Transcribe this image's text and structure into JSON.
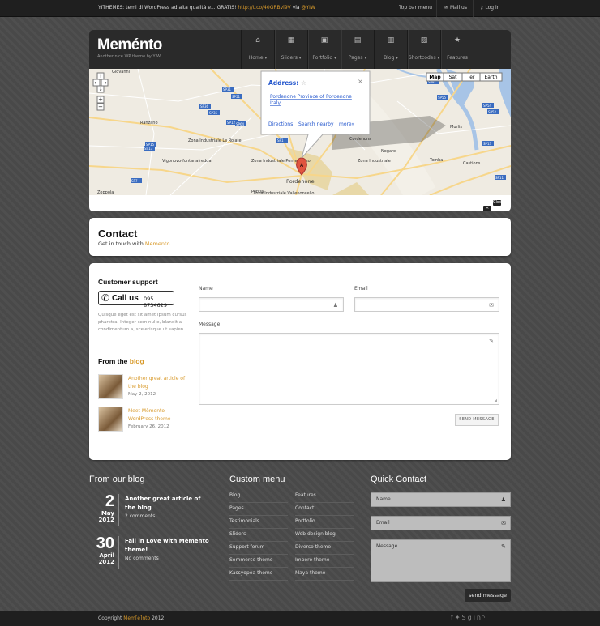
{
  "topbar": {
    "tweet_prefix": "YITHEMES: temi di WordPress ad alta qualità e... GRATIS!",
    "tweet_link": "http://t.co/40GRBvl9V",
    "tweet_via": "via",
    "tweet_user": "@YIW",
    "menu": "Top bar menu",
    "mail": "Mail us",
    "login": "Log in"
  },
  "header": {
    "logo_a": "Mem",
    "logo_accent": "é",
    "logo_b": "nto",
    "tagline": "Another nice WP theme by YIW",
    "nav": [
      {
        "label": "Home",
        "icon": "home-icon",
        "glyph": "⌂",
        "dd": true
      },
      {
        "label": "Sliders",
        "icon": "film-icon",
        "glyph": "▦",
        "dd": true
      },
      {
        "label": "Portfolio",
        "icon": "image-icon",
        "glyph": "▣",
        "dd": true
      },
      {
        "label": "Pages",
        "icon": "document-icon",
        "glyph": "▤",
        "dd": true
      },
      {
        "label": "Blog",
        "icon": "blog-icon",
        "glyph": "▥",
        "dd": true
      },
      {
        "label": "Shortcodes",
        "icon": "code-icon",
        "glyph": "▧",
        "dd": true
      },
      {
        "label": "Features",
        "icon": "star-icon",
        "glyph": "★",
        "dd": false
      }
    ]
  },
  "map": {
    "types": [
      "Map",
      "Sat",
      "Ter",
      "Earth"
    ],
    "info_title": "Address:",
    "info_link1": "Pordenone Province of Pordenone",
    "info_link2": "Italy",
    "directions": "Directions",
    "search_nearby": "Search nearby",
    "more": "more»",
    "marker": "A",
    "close_map": "Close Map",
    "places": [
      "Giovanni",
      "Ranzano",
      "Zona Industriale Le Roiate",
      "Zona Industriale Ponte Rosso",
      "Zona Industriale Vallenoncello",
      "Zona Industriale",
      "Vigonovo-fontanafredda",
      "Pordenone",
      "Porcia",
      "Cordenons",
      "Murlis",
      "Castions",
      "Zoppola",
      "Tomba",
      "Nogare",
      "Roveredo"
    ],
    "roads": [
      "SP31",
      "SP51",
      "SP36",
      "SP35",
      "SP12",
      "SP64",
      "SP15",
      "SS13",
      "SP7",
      "SP1",
      "SP80",
      "SP81",
      "SP55",
      "SP54",
      "SP52",
      "SP13",
      "SP11"
    ]
  },
  "contact": {
    "title": "Contact",
    "subtitle_pre": "Get in touch with",
    "subtitle_link": "Memento"
  },
  "sidebar": {
    "support_title": "Customer support",
    "call_label": "Call us",
    "call_number": "095. 8734629",
    "support_text": "Quisque eget est sit amet ipsum cursus pharetra. Integer sem nulle, blandit a condimentum a, scelerisque ut sapien.",
    "blog_title_pre": "From the",
    "blog_title_accent": "blog",
    "posts": [
      {
        "title": "Another great article of the blog",
        "date": "May 2, 2012"
      },
      {
        "title": "Meet Mèmento WordPress theme",
        "date": "February 26, 2012"
      }
    ]
  },
  "form": {
    "name_label": "Name",
    "email_label": "Email",
    "message_label": "Message",
    "send": "SEND MESSAGE"
  },
  "footer": {
    "blog_title": "From our blog",
    "menu_title": "Custom menu",
    "quick_title": "Quick Contact",
    "posts": [
      {
        "day": "2",
        "month": "May",
        "year": "2012",
        "title": "Another great article of the blog",
        "comments": "2 comments"
      },
      {
        "day": "30",
        "month": "April",
        "year": "2012",
        "title": "Fall in Love with Mèmento theme!",
        "comments": "No comments"
      }
    ],
    "menu_col1": [
      "Blog",
      "Pages",
      "Testimonials",
      "Sliders",
      "Support forum",
      "Sommerce theme",
      "Kassyopea theme"
    ],
    "menu_col2": [
      "Features",
      "Contact",
      "Portfolio",
      "Web design blog",
      "Diverso theme",
      "Impero theme",
      "Maya theme"
    ],
    "name_ph": "Name",
    "email_ph": "Email",
    "message_ph": "Message",
    "send": "send message"
  },
  "copyright": {
    "pre": "Copyright",
    "brand": "Mem[é]nto",
    "year": "2012"
  },
  "colors": {
    "accent": "#d89a2b",
    "dark": "#2a2a2a"
  }
}
